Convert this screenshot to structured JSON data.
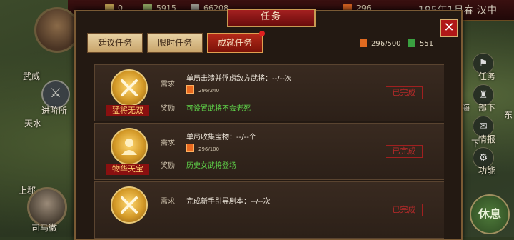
{
  "topbar": {
    "resources": [
      {
        "icon": "grain-icon",
        "value": "0"
      },
      {
        "icon": "coin-icon",
        "value": "5915"
      },
      {
        "icon": "soldier-icon",
        "value": "66208"
      },
      {
        "icon": "token-icon",
        "value": "296"
      }
    ],
    "date": "195年1月春 汉中"
  },
  "map_labels": {
    "wuwei": "武威",
    "jinxiusuo": "进阶所",
    "tianshui": "天水",
    "shangjun": "上郡",
    "hero_name": "司马徽"
  },
  "right_menu": [
    {
      "icon": "flag-icon",
      "label": "任务"
    },
    {
      "icon": "soldier-group-icon",
      "label": "部下"
    },
    {
      "icon": "scroll-icon",
      "label": "情报"
    },
    {
      "icon": "gear-icon",
      "label": "功能"
    }
  ],
  "right_edge": {
    "hai": "海",
    "dong": "东",
    "xia": "下"
  },
  "rest_button": "休息",
  "dialog": {
    "title": "任务",
    "close": "✕",
    "tabs": [
      "廷议任务",
      "限时任务",
      "成就任务"
    ],
    "active_tab": 2,
    "stat_tokens": "296/500",
    "stat_gems": "551"
  },
  "tasks": [
    {
      "name": "猛将无双",
      "req_label": "需求",
      "reward_label": "奖励",
      "requirement": "单局击溃并俘虏敌方武将：--/--次",
      "progress": "296/240",
      "reward": "可设置武将不会老死",
      "status": "已完成",
      "icon": "swords-icon"
    },
    {
      "name": "物华天宝",
      "req_label": "需求",
      "reward_label": "奖励",
      "requirement": "单局收集宝物：--/--个",
      "progress": "296/100",
      "reward": "历史女武将登场",
      "status": "已完成",
      "icon": "bust-icon"
    },
    {
      "name": "",
      "req_label": "需求",
      "reward_label": "",
      "requirement": "完成新手引导剧本：--/--次",
      "progress": "",
      "reward": "",
      "status": "已完成",
      "icon": "swords-icon"
    }
  ],
  "colors": {
    "accent_red": "#a42020",
    "reward_green": "#5fd44a",
    "gold": "#d49a28"
  }
}
